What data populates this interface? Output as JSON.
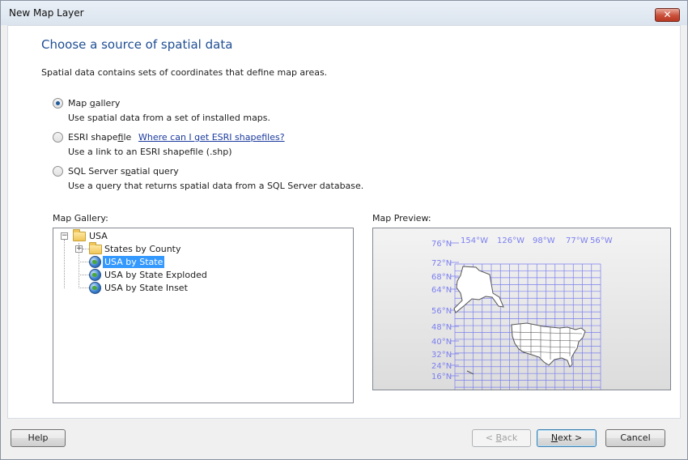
{
  "window": {
    "title": "New Map Layer",
    "close_glyph": "✕"
  },
  "page": {
    "heading": "Choose a source of spatial data",
    "description": "Spatial data contains sets of coordinates that define map areas."
  },
  "options": [
    {
      "label_pre": "Map ",
      "label_ul": "g",
      "label_post": "allery",
      "sub": "Use spatial data from a set of installed maps.",
      "checked": true
    },
    {
      "label_pre": "ESRI shape",
      "label_ul": "f",
      "label_post": "ile",
      "sub": "Use a link to an ESRI shapefile (.shp)",
      "link": "Where can I get ESRI shapefiles?",
      "checked": false
    },
    {
      "label_pre": "SQL Server s",
      "label_ul": "p",
      "label_post": "atial query",
      "sub": "Use a query that returns spatial data from a SQL Server database.",
      "checked": false
    }
  ],
  "gallery": {
    "label": "Map Gallery:",
    "root": {
      "label": "USA",
      "expander": "−"
    },
    "items": [
      {
        "label": "States by County",
        "expander": "+",
        "icon": "folder-icon"
      },
      {
        "label": "USA by State",
        "icon": "globe-icon",
        "selected": true
      },
      {
        "label": "USA by State Exploded",
        "icon": "globe-icon"
      },
      {
        "label": "USA by State Inset",
        "icon": "globe-icon"
      }
    ]
  },
  "preview": {
    "label": "Map Preview:",
    "lat_labels": [
      "76°N",
      "72°N",
      "68°N",
      "64°N",
      "56°N",
      "48°N",
      "40°N",
      "32°N",
      "24°N",
      "16°N"
    ],
    "lon_labels": [
      "154°W",
      "126°W",
      "98°W",
      "77°W",
      "56°W"
    ],
    "grid_color": "#7b7ff0"
  },
  "buttons": {
    "help": "Help",
    "back_ul": "B",
    "back_rest": "ack",
    "back_prefix": "< ",
    "next_ul": "N",
    "next_rest": "ext >",
    "cancel": "Cancel"
  }
}
